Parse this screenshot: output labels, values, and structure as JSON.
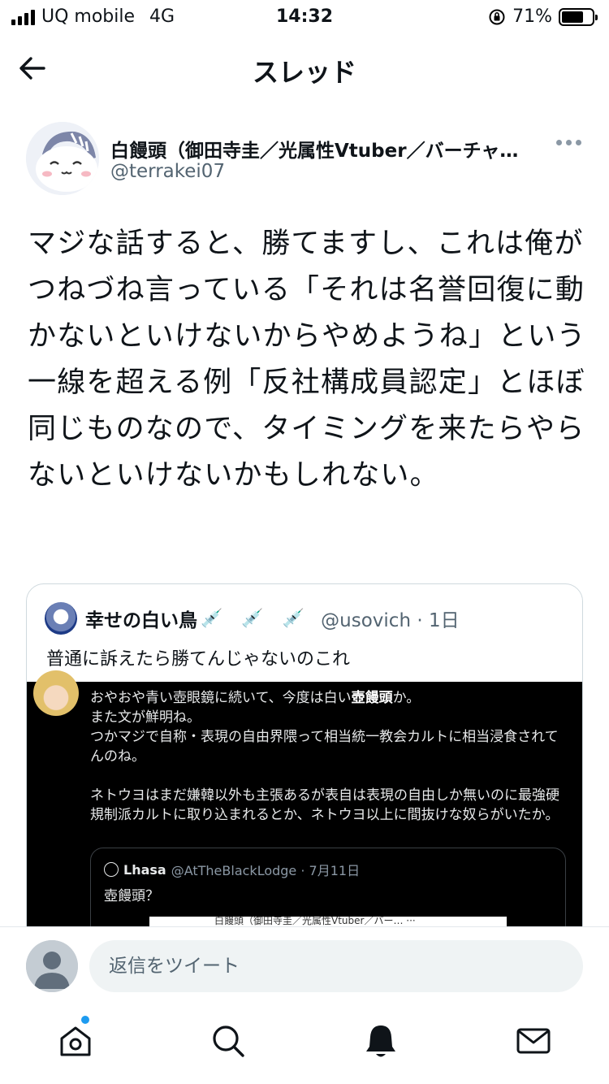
{
  "status_bar": {
    "carrier": "UQ mobile",
    "network": "4G",
    "time": "14:32",
    "battery_percent": "71%",
    "battery_level": 0.71
  },
  "header": {
    "title": "スレッド",
    "back_icon": "arrow-left-icon"
  },
  "tweet": {
    "author_name": "白饅頭（御田寺圭／光属性Vtuber／バーチャ…",
    "author_handle": "@terrakei07",
    "text": "マジな話すると、勝てますし、これは俺がつねづね言っている「それは名誉回復に動かないといけないからやめようね」という一線を超える例「反社構成員認定」とほぼ同じものなので、タイミングを来たらやらないといけないかもしれない。"
  },
  "quote": {
    "name": "幸せの白い鳥",
    "syringes": "💉 💉 💉",
    "handle_time": "@usovich · 1日",
    "text": "普通に訴えたら勝てんじゃないのこれ",
    "image": {
      "line1": "おやおや青い壺眼鏡に続いて、今度は白い",
      "line1_bold": "壺饅頭",
      "line1_end": "か。",
      "line2": "また文が鮮明ね。",
      "line3": "つかマジで自称・表現の自由界隈って相当統一教会カルトに相当浸食されてんのね。",
      "line4": "ネトウヨはまだ嫌韓以外も主張あるが表自は表現の自由しか無いのに最強硬規制派カルトに取り込まれるとか、ネトウヨ以上に間抜けな奴らがいたか。",
      "inner_name": "Lhasa",
      "inner_handle": "@AtTheBlackLodge · 7月11日",
      "inner_text": "壺饅頭？",
      "inner_peek": "白饅頭（御田寺圭／光属性Vtuber／バー… ···"
    }
  },
  "reply": {
    "placeholder": "返信をツイート"
  },
  "tabs": [
    {
      "name": "home-icon"
    },
    {
      "name": "search-icon"
    },
    {
      "name": "notifications-icon"
    },
    {
      "name": "messages-icon"
    }
  ],
  "colors": {
    "accent": "#1d9bf0",
    "secondary_text": "#536471"
  }
}
